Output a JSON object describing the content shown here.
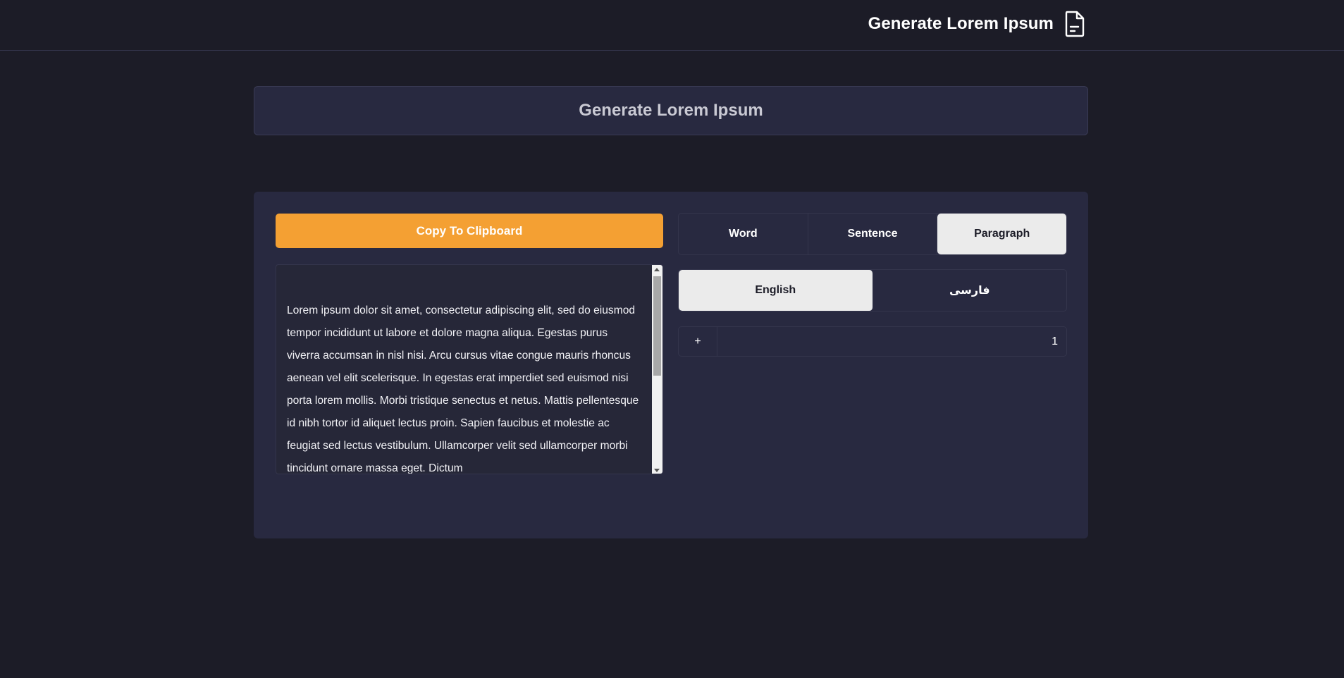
{
  "header": {
    "title": "Generate Lorem Ipsum",
    "icon": "document-icon"
  },
  "title_card": {
    "title": "Generate Lorem Ipsum"
  },
  "actions": {
    "copy_label": "Copy To Clipboard"
  },
  "output": {
    "text": "Lorem ipsum dolor sit amet, consectetur adipiscing elit, sed do eiusmod tempor incididunt ut labore et dolore magna aliqua. Egestas purus viverra accumsan in nisl nisi. Arcu cursus vitae congue mauris rhoncus aenean vel elit scelerisque. In egestas erat imperdiet sed euismod nisi porta lorem mollis. Morbi tristique senectus et netus. Mattis pellentesque id nibh tortor id aliquet lectus proin. Sapien faucibus et molestie ac feugiat sed lectus vestibulum. Ullamcorper velit sed ullamcorper morbi tincidunt ornare massa eget. Dictum"
  },
  "mode_tabs": [
    {
      "label": "Word",
      "active": false
    },
    {
      "label": "Sentence",
      "active": false
    },
    {
      "label": "Paragraph",
      "active": true
    }
  ],
  "language_tabs": [
    {
      "label": "English",
      "active": true
    },
    {
      "label": "فارسی",
      "active": false
    }
  ],
  "count": {
    "plus_label": "+",
    "value": "1"
  },
  "colors": {
    "background": "#1c1c27",
    "panel": "#282940",
    "accent": "#f4a033",
    "active_tab": "#ebebeb"
  }
}
